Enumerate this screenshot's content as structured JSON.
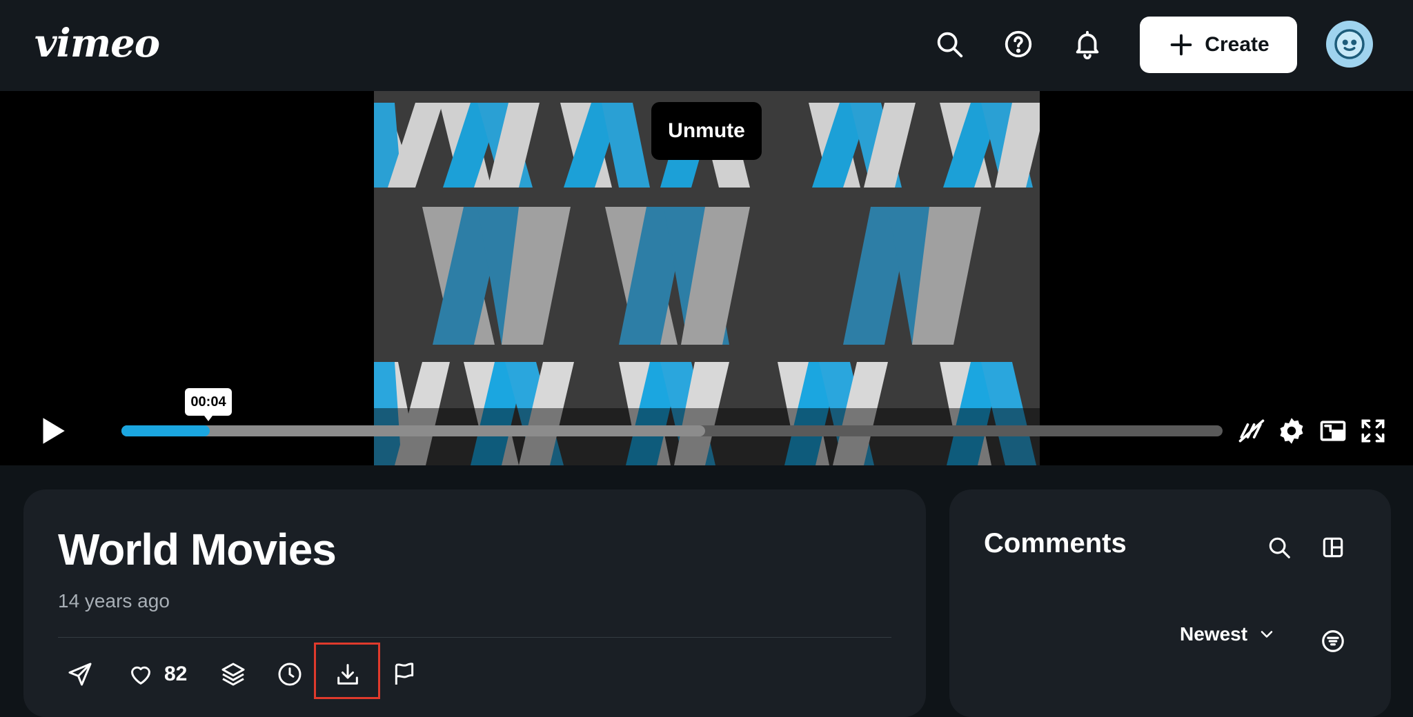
{
  "header": {
    "logo_text": "vimeo",
    "create_label": "Create",
    "icons": [
      "search-icon",
      "help-icon",
      "bell-icon",
      "plus-icon",
      "avatar"
    ]
  },
  "player": {
    "tooltip": "Unmute",
    "time_tooltip": "00:04",
    "progress_fraction": 0.08,
    "buffer_fraction": 0.53,
    "accent_color": "#1ba6e0",
    "icons": [
      "play-icon",
      "hd-off-icon",
      "settings-icon",
      "picture-in-picture-icon",
      "fullscreen-icon"
    ]
  },
  "video": {
    "title": "World Movies",
    "age": "14 years ago",
    "likes": "82",
    "actions": [
      "share-icon",
      "like-icon",
      "collections-icon",
      "watch-later-icon",
      "download-icon",
      "report-flag-icon"
    ]
  },
  "comments": {
    "title": "Comments",
    "sort_label": "Newest",
    "icons": [
      "search-icon",
      "layout-icon",
      "chevron-down-icon",
      "filter-icon"
    ]
  }
}
